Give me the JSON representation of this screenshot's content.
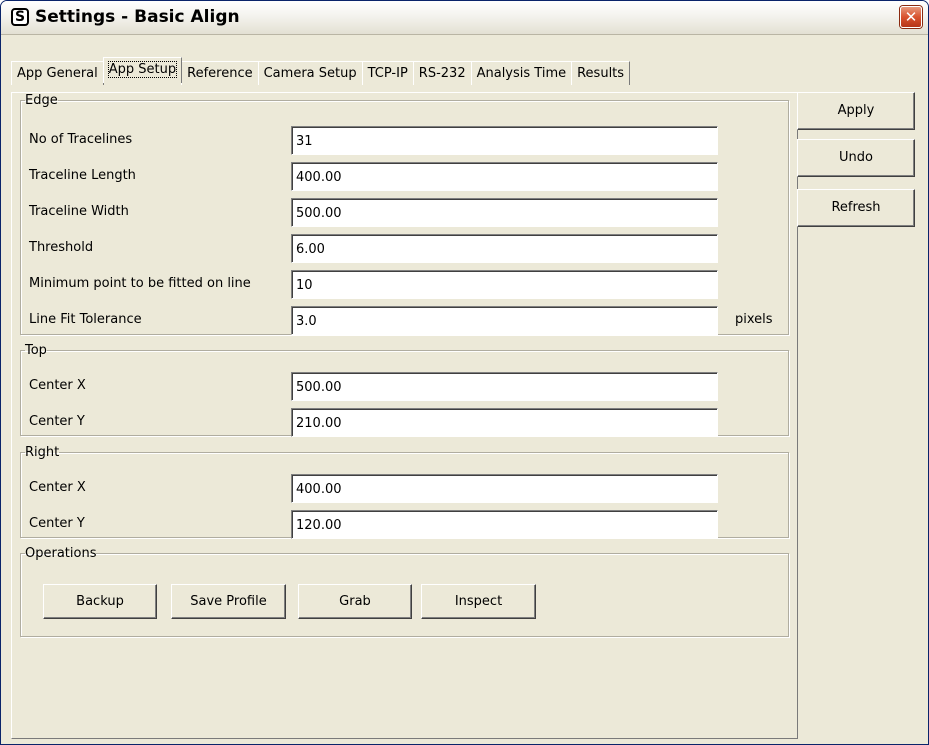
{
  "window": {
    "title": "Settings - Basic Align",
    "close_glyph": "✕",
    "app_icon_glyph": "S"
  },
  "tabs": [
    {
      "label": "App General",
      "active": false
    },
    {
      "label": "App Setup",
      "active": true
    },
    {
      "label": "Reference",
      "active": false
    },
    {
      "label": "Camera Setup",
      "active": false
    },
    {
      "label": "TCP-IP",
      "active": false
    },
    {
      "label": "RS-232",
      "active": false
    },
    {
      "label": "Analysis Time",
      "active": false
    },
    {
      "label": "Results",
      "active": false
    }
  ],
  "edge": {
    "title": "Edge",
    "fields": [
      {
        "label": "No of Tracelines",
        "value": "31"
      },
      {
        "label": "Traceline Length",
        "value": "400.00"
      },
      {
        "label": "Traceline Width",
        "value": "500.00"
      },
      {
        "label": "Threshold",
        "value": "6.00"
      },
      {
        "label": "Minimum point to be fitted on line",
        "value": "10"
      },
      {
        "label": "Line Fit Tolerance",
        "value": "3.0",
        "unit": "pixels"
      }
    ]
  },
  "top": {
    "title": "Top",
    "fields": [
      {
        "label": "Center X",
        "value": "500.00"
      },
      {
        "label": "Center Y",
        "value": "210.00"
      }
    ]
  },
  "right": {
    "title": "Right",
    "fields": [
      {
        "label": "Center X",
        "value": "400.00"
      },
      {
        "label": "Center Y",
        "value": "120.00"
      }
    ]
  },
  "operations": {
    "title": "Operations",
    "buttons": [
      "Backup",
      "Save Profile",
      "Grab",
      "Inspect"
    ]
  },
  "side_buttons": {
    "apply": "Apply",
    "undo": "Undo",
    "refresh": "Refresh"
  },
  "colors": {
    "face": "#ece9d8",
    "close": "#d9532f",
    "field_bg": "#ffffff"
  }
}
